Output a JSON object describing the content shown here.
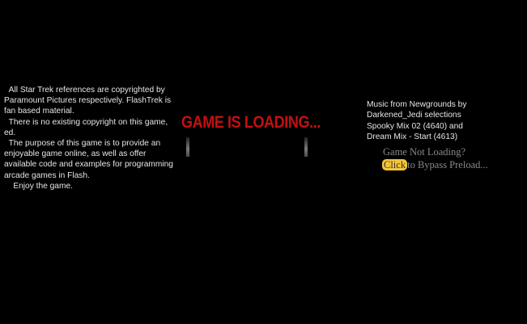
{
  "copyright": {
    "text": "  All Star Trek references are copyrighted by Paramount Pictures respectively. FlashTrek is fan based material.\n  There is no existing copyright on this game, ed.\n  The purpose of this game is to provide an enjoyable game online, as well as offer available code and examples for programming arcade games in Flash.\n    Enjoy the game."
  },
  "loader": {
    "title": "GAME IS LOADING...",
    "progress": 0,
    "title_color": "#c41010"
  },
  "music_credit": {
    "lines": [
      "Music from Newgrounds by",
      "Darkened_Jedi selections",
      "Spooky Mix 02 (4640) and",
      "Dream Mix - Start (4613)"
    ]
  },
  "preload": {
    "question": "Game Not Loading?",
    "button_label": "Click",
    "bypass_text": "to Bypass Preload...",
    "button_color": "#f2c53a"
  }
}
